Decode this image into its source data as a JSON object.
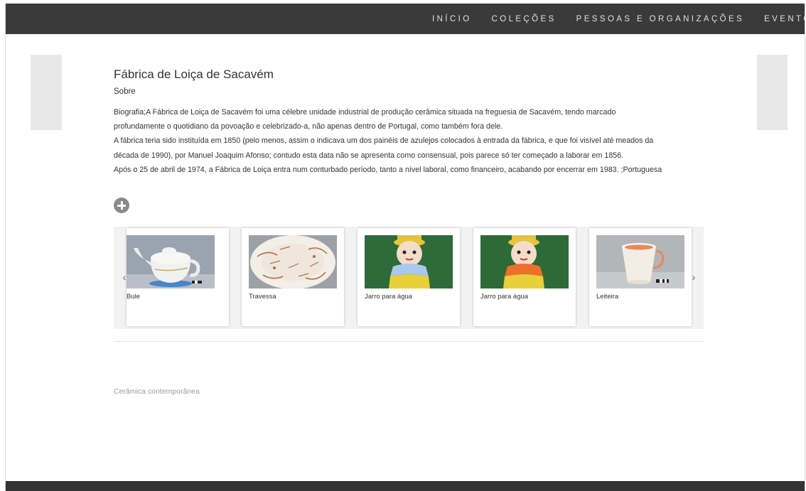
{
  "nav": {
    "items": [
      "INÍCIO",
      "COLEÇÕES",
      "PESSOAS E ORGANIZAÇÕES",
      "EVENTO"
    ]
  },
  "page": {
    "title": "Fábrica de Loiça de Sacavém",
    "subtitle": "Sobre",
    "paragraphs": [
      "Biografia;A Fábrica de Loiça de Sacavém foi uma célebre unidade industrial de produção cerâmica situada na freguesia de Sacavém, tendo marcado",
      "profundamente o quotidiano da povoação e celebrizado-a, não apenas dentro de Portugal, como também fora dele.",
      "A fábrica teria sido instituída em 1850 (pelo menos, assim o indicava um dos painéis de azulejos colocados à entrada da fábrica, e que foi visível até meados da",
      "década de 1990), por Manuel Joaquim Afonso; contudo esta data não se apresenta como consensual, pois parece só ter começado a laborar em 1856.",
      "Após o 25 de abril de 1974, a Fábrica de Loiça entra num conturbado período, tanto a nível laboral, como financeiro, acabando por encerrar em 1983. ;Portuguesa"
    ]
  },
  "carousel": {
    "prev_icon": "chevron-left-icon",
    "next_icon": "chevron-right-icon",
    "prev_glyph": "‹",
    "next_glyph": "›",
    "items": [
      {
        "label": "Bule"
      },
      {
        "label": "Travessa"
      },
      {
        "label": "Jarro para água"
      },
      {
        "label": "Jarro para água"
      },
      {
        "label": "Leiteira"
      }
    ]
  },
  "tags": {
    "link": "Cerâmica contemporânea"
  },
  "colors": {
    "topbar": "#3a3a3a",
    "footer": "#333333",
    "side_panel": "#e8e8e8"
  }
}
